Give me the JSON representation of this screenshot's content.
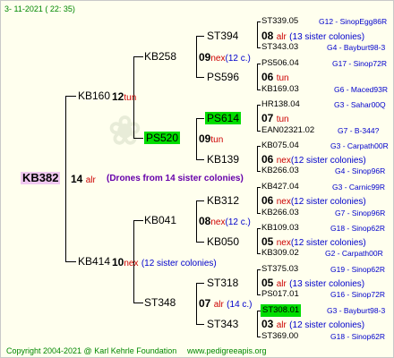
{
  "header_date": "3- 11-2021 ( 22: 35)",
  "footer": {
    "copyright": "Copyright 2004-2021 @ Karl Kehrle Foundation",
    "url": "www.pedigreeapis.org"
  },
  "root": {
    "name": "KB382",
    "gen": "14",
    "mark": "alr",
    "note": "(Drones from 14 sister colonies)"
  },
  "nodes": {
    "kb160": "KB160",
    "kb414": "KB414",
    "kb258": "KB258",
    "ps520": "PS520",
    "kb041": "KB041",
    "st348": "ST348",
    "st394": "ST394",
    "ps596": "PS596",
    "ps614": "PS614",
    "kb139": "KB139",
    "kb312": "KB312",
    "kb050": "KB050",
    "st318": "ST318",
    "st343": "ST343"
  },
  "gens": {
    "kb160": {
      "num": "12",
      "mark": "tun",
      "note": ""
    },
    "kb414": {
      "num": "10",
      "mark": "nex",
      "note": "(12 sister colonies)"
    },
    "kb258": {
      "num": "09",
      "mark": "nex",
      "note": "(12 c.)"
    },
    "ps520": {
      "num": "09",
      "mark": "tun",
      "note": ""
    },
    "kb041": {
      "num": "08",
      "mark": "nex",
      "note": "(12 c.)"
    },
    "st348": {
      "num": "07",
      "mark": "alr",
      "note": "(14 c.)"
    },
    "st394": {
      "num": "08",
      "mark": "alr",
      "note": "(13 sister colonies)"
    },
    "ps596": {
      "num": "06",
      "mark": "tun",
      "note": ""
    },
    "ps614": {
      "num": "07",
      "mark": "tun",
      "note": ""
    },
    "kb139": {
      "num": "06",
      "mark": "nex",
      "note": "(12 sister colonies)"
    },
    "kb312": {
      "num": "06",
      "mark": "nex",
      "note": "(12 sister colonies)"
    },
    "kb050": {
      "num": "05",
      "mark": "nex",
      "note": "(12 sister colonies)"
    },
    "st318": {
      "num": "05",
      "mark": "alr",
      "note": "(13 sister colonies)"
    },
    "st343": {
      "num": "03",
      "mark": "alr",
      "note": "(12 sister colonies)"
    }
  },
  "leaves": {
    "l1": {
      "name": "ST339.05",
      "code": "G12 - SinopEgg86R"
    },
    "l2": {
      "name": "ST343.03",
      "code": "G4 - Bayburt98-3"
    },
    "l3": {
      "name": "PS506.04",
      "code": "G17 - Sinop72R"
    },
    "l4": {
      "name": "KB169.03",
      "code": "G6 - Maced93R"
    },
    "l5": {
      "name": "HR138.04",
      "code": "G3 - Sahar00Q"
    },
    "l6": {
      "name": "EAN02321.02",
      "code": "G7 - B-344?"
    },
    "l7": {
      "name": "KB075.04",
      "code": "G3 - Carpath00R"
    },
    "l8": {
      "name": "KB266.03",
      "code": "G4 - Sinop96R"
    },
    "l9": {
      "name": "KB427.04",
      "code": "G3 - Carnic99R"
    },
    "l10": {
      "name": "KB266.03",
      "code": "G7 - Sinop96R"
    },
    "l11": {
      "name": "KB109.03",
      "code": "G18 - Sinop62R"
    },
    "l12": {
      "name": "KB309.02",
      "code": "G2 - Carpath00R"
    },
    "l13": {
      "name": "ST375.03",
      "code": "G19 - Sinop62R"
    },
    "l14": {
      "name": "PS017.01",
      "code": "G16 - Sinop72R"
    },
    "l15": {
      "name": "ST308.01",
      "code": "G3 - Bayburt98-3"
    },
    "l16": {
      "name": "ST369.00",
      "code": "G18 - Sinop62R"
    }
  }
}
